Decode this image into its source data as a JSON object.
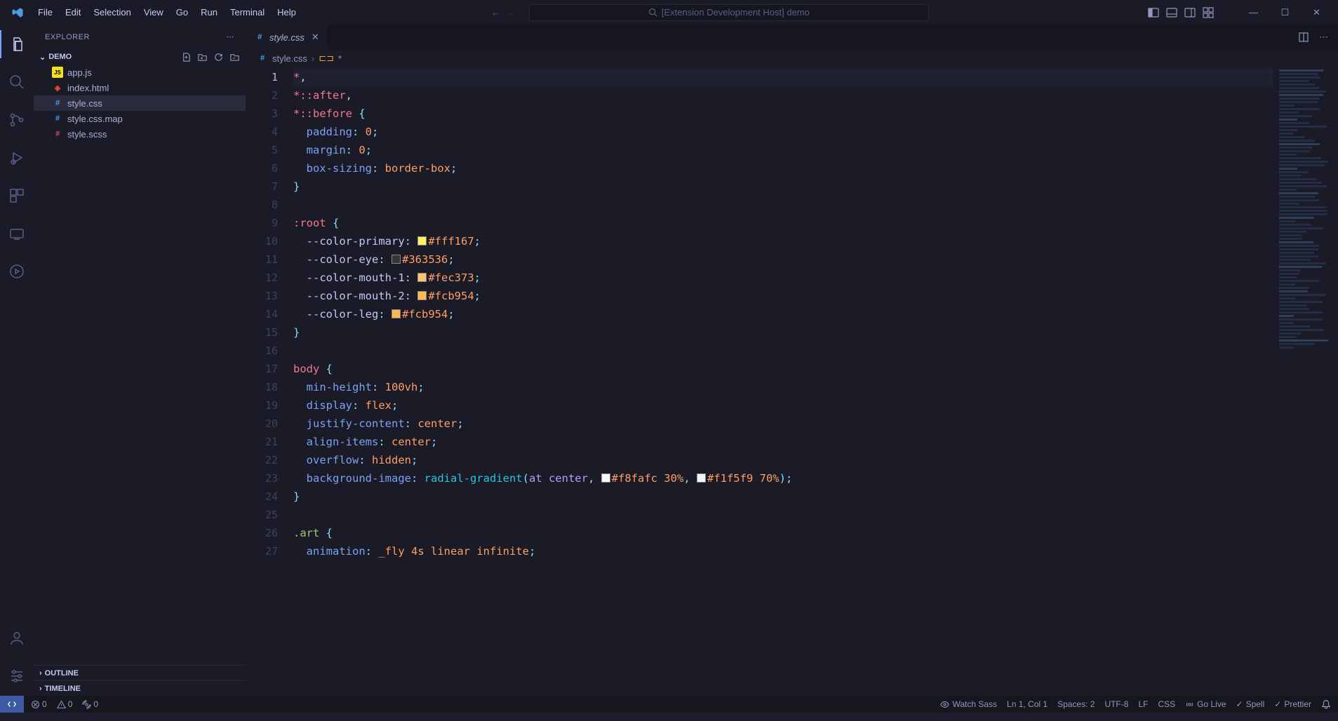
{
  "titlebar": {
    "menu": [
      "File",
      "Edit",
      "Selection",
      "View",
      "Go",
      "Run",
      "Terminal",
      "Help"
    ],
    "search_placeholder": "[Extension Development Host] demo"
  },
  "sidebar": {
    "title": "EXPLORER",
    "folder": "DEMO",
    "files": [
      {
        "name": "app.js",
        "icon": "js"
      },
      {
        "name": "index.html",
        "icon": "html"
      },
      {
        "name": "style.css",
        "icon": "css"
      },
      {
        "name": "style.css.map",
        "icon": "css"
      },
      {
        "name": "style.scss",
        "icon": "scss"
      }
    ],
    "outline": "OUTLINE",
    "timeline": "TIMELINE"
  },
  "tab": {
    "label": "style.css"
  },
  "breadcrumb": {
    "file": "style.css",
    "symbol": "*"
  },
  "code": {
    "lines": [
      {
        "n": 1,
        "tokens": [
          {
            "t": "*",
            "c": "sel"
          },
          {
            "t": ",",
            "c": "white"
          }
        ]
      },
      {
        "n": 2,
        "tokens": [
          {
            "t": "*::after",
            "c": "sel"
          },
          {
            "t": ",",
            "c": "white"
          }
        ]
      },
      {
        "n": 3,
        "tokens": [
          {
            "t": "*::before ",
            "c": "sel"
          },
          {
            "t": "{",
            "c": "punct"
          }
        ]
      },
      {
        "n": 4,
        "tokens": [
          {
            "t": "  ",
            "c": "white"
          },
          {
            "t": "padding",
            "c": "prop"
          },
          {
            "t": ": ",
            "c": "punct"
          },
          {
            "t": "0",
            "c": "val"
          },
          {
            "t": ";",
            "c": "punct"
          }
        ]
      },
      {
        "n": 5,
        "tokens": [
          {
            "t": "  ",
            "c": "white"
          },
          {
            "t": "margin",
            "c": "prop"
          },
          {
            "t": ": ",
            "c": "punct"
          },
          {
            "t": "0",
            "c": "val"
          },
          {
            "t": ";",
            "c": "punct"
          }
        ]
      },
      {
        "n": 6,
        "tokens": [
          {
            "t": "  ",
            "c": "white"
          },
          {
            "t": "box-sizing",
            "c": "prop"
          },
          {
            "t": ": ",
            "c": "punct"
          },
          {
            "t": "border-box",
            "c": "val"
          },
          {
            "t": ";",
            "c": "punct"
          }
        ]
      },
      {
        "n": 7,
        "tokens": [
          {
            "t": "}",
            "c": "punct"
          }
        ]
      },
      {
        "n": 8,
        "tokens": []
      },
      {
        "n": 9,
        "tokens": [
          {
            "t": ":root ",
            "c": "sel"
          },
          {
            "t": "{",
            "c": "punct"
          }
        ]
      },
      {
        "n": 10,
        "tokens": [
          {
            "t": "  ",
            "c": "white"
          },
          {
            "t": "--color-primary",
            "c": "var"
          },
          {
            "t": ": ",
            "c": "punct"
          },
          {
            "sw": "#fff167"
          },
          {
            "t": "#fff167",
            "c": "val"
          },
          {
            "t": ";",
            "c": "punct"
          }
        ]
      },
      {
        "n": 11,
        "tokens": [
          {
            "t": "  ",
            "c": "white"
          },
          {
            "t": "--color-eye",
            "c": "var"
          },
          {
            "t": ": ",
            "c": "punct"
          },
          {
            "sw": "#363536"
          },
          {
            "t": "#363536",
            "c": "val"
          },
          {
            "t": ";",
            "c": "punct"
          }
        ]
      },
      {
        "n": 12,
        "tokens": [
          {
            "t": "  ",
            "c": "white"
          },
          {
            "t": "--color-mouth-1",
            "c": "var"
          },
          {
            "t": ": ",
            "c": "punct"
          },
          {
            "sw": "#fec373"
          },
          {
            "t": "#fec373",
            "c": "val"
          },
          {
            "t": ";",
            "c": "punct"
          }
        ]
      },
      {
        "n": 13,
        "tokens": [
          {
            "t": "  ",
            "c": "white"
          },
          {
            "t": "--color-mouth-2",
            "c": "var"
          },
          {
            "t": ": ",
            "c": "punct"
          },
          {
            "sw": "#fcb954"
          },
          {
            "t": "#fcb954",
            "c": "val"
          },
          {
            "t": ";",
            "c": "punct"
          }
        ]
      },
      {
        "n": 14,
        "tokens": [
          {
            "t": "  ",
            "c": "white"
          },
          {
            "t": "--color-leg",
            "c": "var"
          },
          {
            "t": ": ",
            "c": "punct"
          },
          {
            "sw": "#fcb954"
          },
          {
            "t": "#fcb954",
            "c": "val"
          },
          {
            "t": ";",
            "c": "punct"
          }
        ]
      },
      {
        "n": 15,
        "tokens": [
          {
            "t": "}",
            "c": "punct"
          }
        ]
      },
      {
        "n": 16,
        "tokens": []
      },
      {
        "n": 17,
        "tokens": [
          {
            "t": "body ",
            "c": "sel"
          },
          {
            "t": "{",
            "c": "punct"
          }
        ]
      },
      {
        "n": 18,
        "tokens": [
          {
            "t": "  ",
            "c": "white"
          },
          {
            "t": "min-height",
            "c": "prop"
          },
          {
            "t": ": ",
            "c": "punct"
          },
          {
            "t": "100vh",
            "c": "val"
          },
          {
            "t": ";",
            "c": "punct"
          }
        ]
      },
      {
        "n": 19,
        "tokens": [
          {
            "t": "  ",
            "c": "white"
          },
          {
            "t": "display",
            "c": "prop"
          },
          {
            "t": ": ",
            "c": "punct"
          },
          {
            "t": "flex",
            "c": "val"
          },
          {
            "t": ";",
            "c": "punct"
          }
        ]
      },
      {
        "n": 20,
        "tokens": [
          {
            "t": "  ",
            "c": "white"
          },
          {
            "t": "justify-content",
            "c": "prop"
          },
          {
            "t": ": ",
            "c": "punct"
          },
          {
            "t": "center",
            "c": "val"
          },
          {
            "t": ";",
            "c": "punct"
          }
        ]
      },
      {
        "n": 21,
        "tokens": [
          {
            "t": "  ",
            "c": "white"
          },
          {
            "t": "align-items",
            "c": "prop"
          },
          {
            "t": ": ",
            "c": "punct"
          },
          {
            "t": "center",
            "c": "val"
          },
          {
            "t": ";",
            "c": "punct"
          }
        ]
      },
      {
        "n": 22,
        "tokens": [
          {
            "t": "  ",
            "c": "white"
          },
          {
            "t": "overflow",
            "c": "prop"
          },
          {
            "t": ": ",
            "c": "punct"
          },
          {
            "t": "hidden",
            "c": "val"
          },
          {
            "t": ";",
            "c": "punct"
          }
        ]
      },
      {
        "n": 23,
        "tokens": [
          {
            "t": "  ",
            "c": "white"
          },
          {
            "t": "background-image",
            "c": "prop"
          },
          {
            "t": ": ",
            "c": "punct"
          },
          {
            "t": "radial-gradient",
            "c": "func"
          },
          {
            "t": "(",
            "c": "punct"
          },
          {
            "t": "at center",
            "c": "kw"
          },
          {
            "t": ", ",
            "c": "punct"
          },
          {
            "sw": "#f8fafc"
          },
          {
            "t": "#f8fafc 30%",
            "c": "val"
          },
          {
            "t": ", ",
            "c": "punct"
          },
          {
            "sw": "#f1f5f9"
          },
          {
            "t": "#f1f5f9 70%",
            "c": "val"
          },
          {
            "t": ");",
            "c": "punct"
          }
        ]
      },
      {
        "n": 24,
        "tokens": [
          {
            "t": "}",
            "c": "punct"
          }
        ]
      },
      {
        "n": 25,
        "tokens": []
      },
      {
        "n": 26,
        "tokens": [
          {
            "t": ".art ",
            "c": "class"
          },
          {
            "t": "{",
            "c": "punct"
          }
        ]
      },
      {
        "n": 27,
        "tokens": [
          {
            "t": "  ",
            "c": "white"
          },
          {
            "t": "animation",
            "c": "prop"
          },
          {
            "t": ": ",
            "c": "punct"
          },
          {
            "t": "_fly 4s linear infinite",
            "c": "val"
          },
          {
            "t": ";",
            "c": "punct"
          }
        ]
      }
    ]
  },
  "statusbar": {
    "errors": "0",
    "warnings": "0",
    "port": "0",
    "watch": "Watch Sass",
    "position": "Ln 1, Col 1",
    "spaces": "Spaces: 2",
    "encoding": "UTF-8",
    "eol": "LF",
    "lang": "CSS",
    "golive": "Go Live",
    "spell": "Spell",
    "prettier": "Prettier"
  }
}
